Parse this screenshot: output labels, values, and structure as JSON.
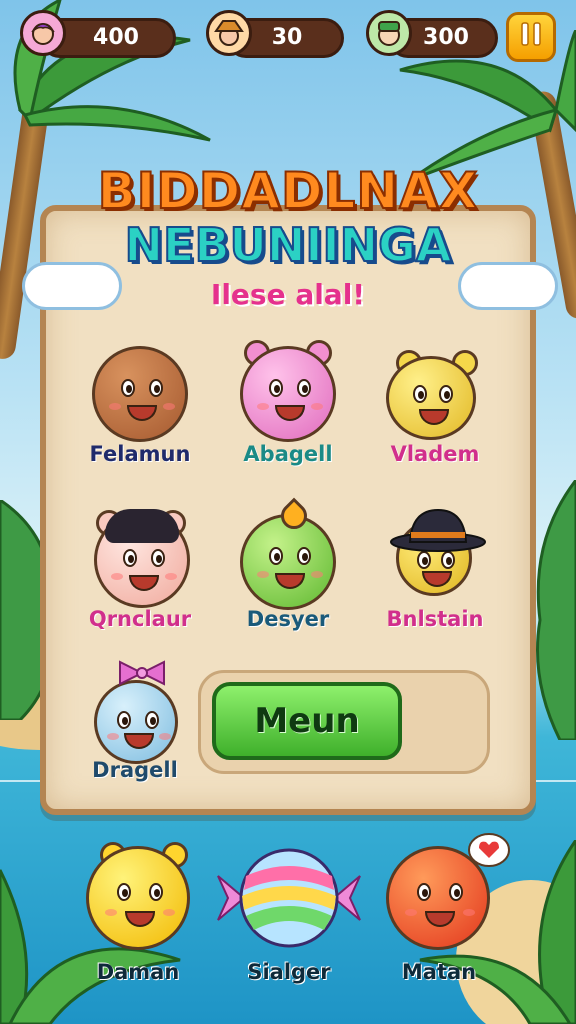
{
  "hud": {
    "player1": {
      "avatar_icon": "purple-hair-girl-icon",
      "value": "400"
    },
    "player2": {
      "avatar_icon": "hat-explorer-icon",
      "value": "30"
    },
    "player3": {
      "avatar_icon": "green-cap-boy-icon",
      "value": "300"
    },
    "pause_icon": "pause-icon"
  },
  "title": {
    "line1": "BIDDADLNAX",
    "line2": "NEBUNIINGA",
    "subtitle": "Ilese alal!"
  },
  "grid": [
    {
      "name": "Felamun",
      "color": "#b36a3c",
      "label_color": "#1f2a6b"
    },
    {
      "name": "Abagell",
      "color": "#f28fd0",
      "label_color": "#1a8a86"
    },
    {
      "name": "Vladem",
      "color": "#f5d84a",
      "label_color": "#d12f8c"
    },
    {
      "name": "Qrnclaur",
      "color": "#f9c9c0",
      "label_color": "#d12f8c"
    },
    {
      "name": "Desyer",
      "color": "#8ad64a",
      "label_color": "#1a5a7a"
    },
    {
      "name": "Bnlstain",
      "color": "#f2cf3a",
      "label_color": "#d12f8c"
    },
    {
      "name": "Dragell",
      "color": "#9ed3ef",
      "label_color": "#1f4a6b"
    }
  ],
  "main_button": {
    "label": "Meun"
  },
  "bottom": [
    {
      "name": "Daman",
      "color": "#ffd52e"
    },
    {
      "name": "Sialger",
      "color": "#c9a0f0"
    },
    {
      "name": "Matan",
      "color": "#ff5a2a"
    }
  ]
}
